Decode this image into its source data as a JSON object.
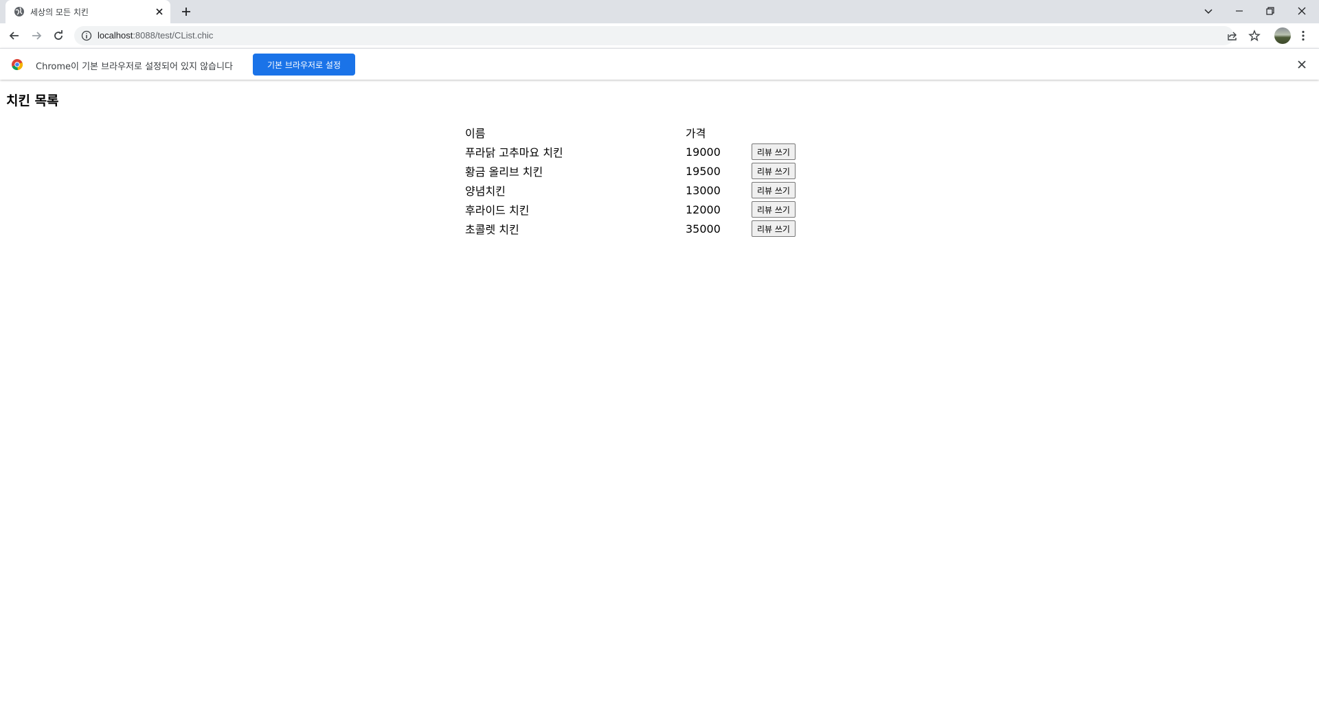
{
  "browser": {
    "tab_title": "세상의 모든 치킨",
    "url_host": "localhost",
    "url_rest": ":8088/test/CList.chic"
  },
  "infobar": {
    "message": "Chrome이 기본 브라우저로 설정되어 있지 않습니다",
    "button_label": "기본 브라우저로 설정"
  },
  "page": {
    "title": "치킨 목록",
    "table": {
      "headers": {
        "name": "이름",
        "price": "가격"
      },
      "rows": [
        {
          "name": "푸라닭 고추마요 치킨",
          "price": "19000",
          "button": "리뷰 쓰기"
        },
        {
          "name": "황금 올리브 치킨",
          "price": "19500",
          "button": "리뷰 쓰기"
        },
        {
          "name": "양념치킨",
          "price": "13000",
          "button": "리뷰 쓰기"
        },
        {
          "name": "후라이드 치킨",
          "price": "12000",
          "button": "리뷰 쓰기"
        },
        {
          "name": "초콜렛 치킨",
          "price": "35000",
          "button": "리뷰 쓰기"
        }
      ]
    }
  },
  "colors": {
    "tabstrip_bg": "#dee1e6",
    "omnibox_bg": "#f1f3f4",
    "infobar_button": "#1a73e8"
  },
  "icons": [
    "globe-icon",
    "close-icon",
    "plus-icon",
    "chevron-down-icon",
    "minimize-icon",
    "restore-icon",
    "back-icon",
    "forward-icon",
    "reload-icon",
    "info-icon",
    "share-icon",
    "star-icon",
    "menu-icon",
    "chrome-logo-icon"
  ]
}
